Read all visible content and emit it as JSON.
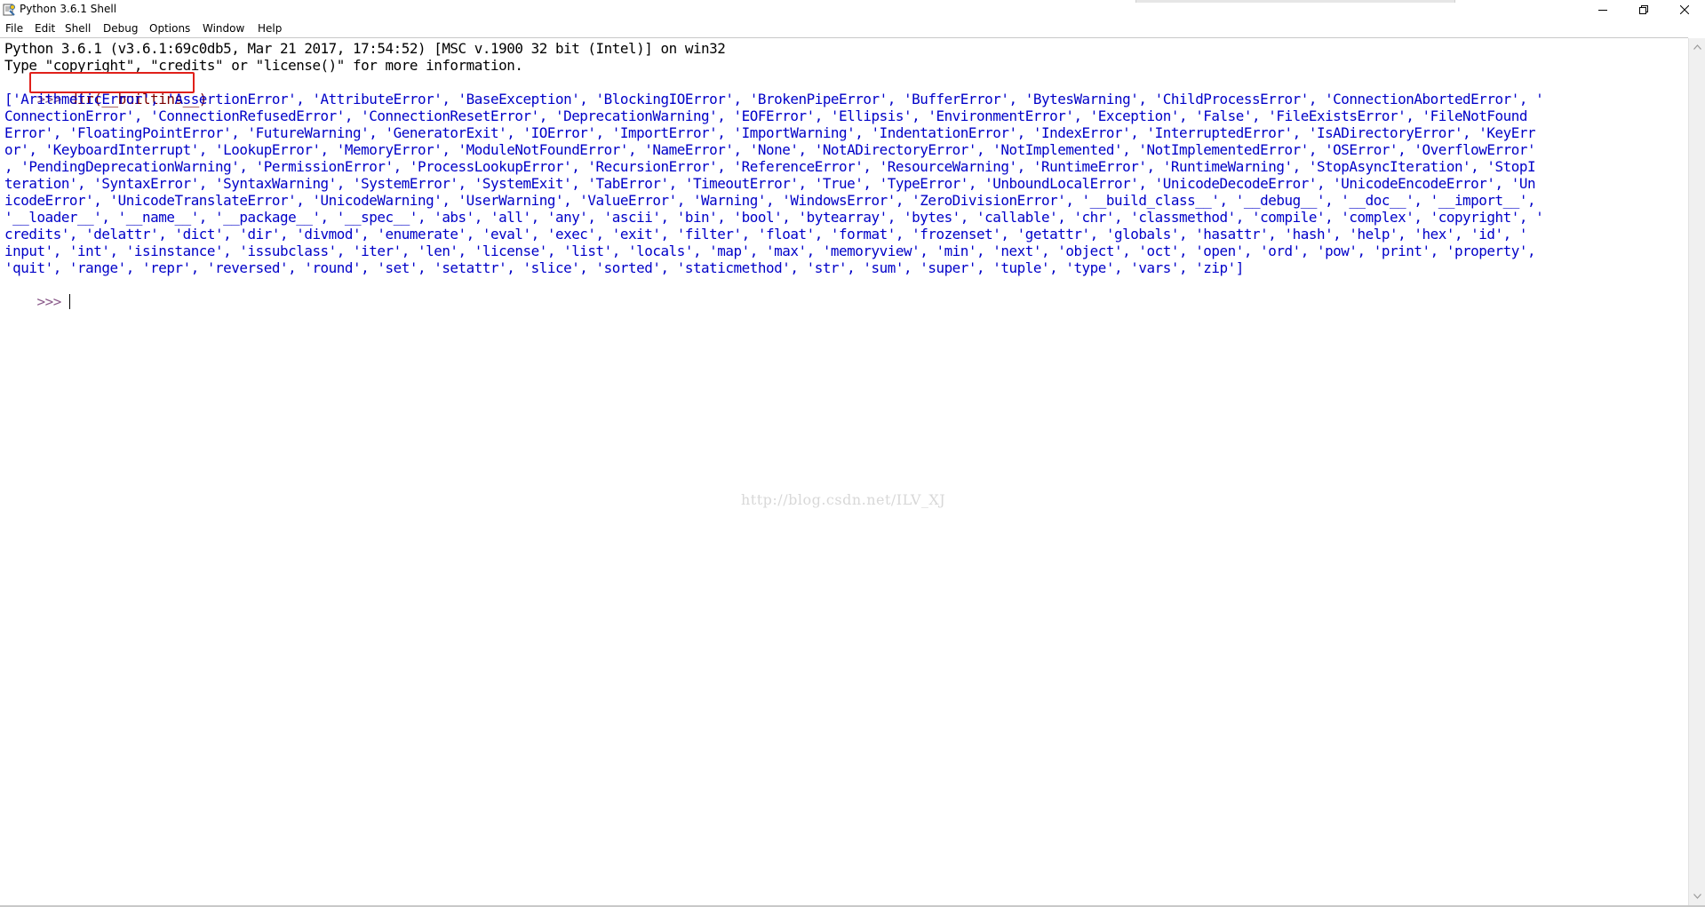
{
  "window": {
    "title": "Python 3.6.1 Shell",
    "app_icon": "python-idle-icon",
    "controls": [
      "minimize-icon",
      "restore-icon",
      "close-icon"
    ]
  },
  "menubar": {
    "items": [
      "File",
      "Edit",
      "Shell",
      "Debug",
      "Options",
      "Window",
      "Help"
    ]
  },
  "shell": {
    "banner_line1": "Python 3.6.1 (v3.6.1:69c0db5, Mar 21 2017, 17:54:52) [MSC v.1900 32 bit (Intel)] on win32",
    "banner_line2": "Type \"copyright\", \"credits\" or \"license()\" for more information.",
    "prompt": ">>> ",
    "command": "dir(__builtins__)",
    "output_lines": [
      "['ArithmeticError', 'AssertionError', 'AttributeError', 'BaseException', 'BlockingIOError', 'BrokenPipeError', 'BufferError', 'BytesWarning', 'ChildProcessError', 'ConnectionAbortedError', '",
      "ConnectionError', 'ConnectionRefusedError', 'ConnectionResetError', 'DeprecationWarning', 'EOFError', 'Ellipsis', 'EnvironmentError', 'Exception', 'False', 'FileExistsError', 'FileNotFound",
      "Error', 'FloatingPointError', 'FutureWarning', 'GeneratorExit', 'IOError', 'ImportError', 'ImportWarning', 'IndentationError', 'IndexError', 'InterruptedError', 'IsADirectoryError', 'KeyErr",
      "or', 'KeyboardInterrupt', 'LookupError', 'MemoryError', 'ModuleNotFoundError', 'NameError', 'None', 'NotADirectoryError', 'NotImplemented', 'NotImplementedError', 'OSError', 'OverflowError'",
      ", 'PendingDeprecationWarning', 'PermissionError', 'ProcessLookupError', 'RecursionError', 'ReferenceError', 'ResourceWarning', 'RuntimeError', 'RuntimeWarning', 'StopAsyncIteration', 'StopI",
      "teration', 'SyntaxError', 'SyntaxWarning', 'SystemError', 'SystemExit', 'TabError', 'TimeoutError', 'True', 'TypeError', 'UnboundLocalError', 'UnicodeDecodeError', 'UnicodeEncodeError', 'Un",
      "icodeError', 'UnicodeTranslateError', 'UnicodeWarning', 'UserWarning', 'ValueError', 'Warning', 'WindowsError', 'ZeroDivisionError', '__build_class__', '__debug__', '__doc__', '__import__',",
      "'__loader__', '__name__', '__package__', '__spec__', 'abs', 'all', 'any', 'ascii', 'bin', 'bool', 'bytearray', 'bytes', 'callable', 'chr', 'classmethod', 'compile', 'complex', 'copyright', '",
      "credits', 'delattr', 'dict', 'dir', 'divmod', 'enumerate', 'eval', 'exec', 'exit', 'filter', 'float', 'format', 'frozenset', 'getattr', 'globals', 'hasattr', 'hash', 'help', 'hex', 'id', '",
      "input', 'int', 'isinstance', 'issubclass', 'iter', 'len', 'license', 'list', 'locals', 'map', 'max', 'memoryview', 'min', 'next', 'object', 'oct', 'open', 'ord', 'pow', 'print', 'property',",
      "'quit', 'range', 'repr', 'reversed', 'round', 'set', 'setattr', 'slice', 'sorted', 'staticmethod', 'str', 'sum', 'super', 'tuple', 'type', 'vars', 'zip']"
    ],
    "final_prompt": ">>> "
  },
  "watermark": "http://blog.csdn.net/ILV_XJ",
  "colors": {
    "stdout": "#000000",
    "output": "#0000c8",
    "prompt": "#8a5a8a",
    "command": "#7a0000",
    "highlight_box": "#e0201a"
  }
}
